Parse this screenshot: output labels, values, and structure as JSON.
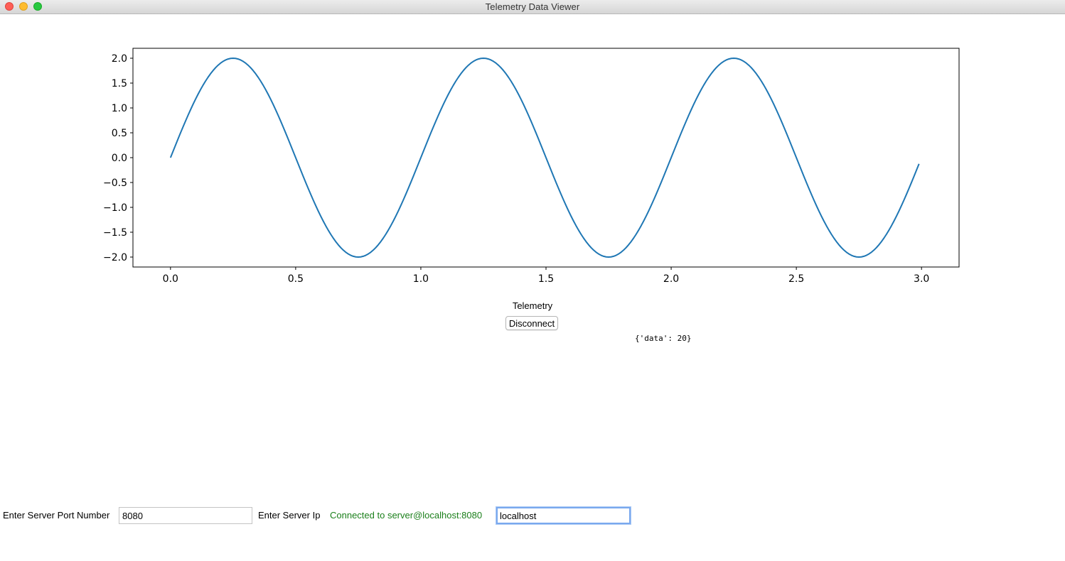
{
  "window": {
    "title": "Telemetry Data Viewer"
  },
  "chart_data": {
    "type": "line",
    "title": "",
    "xlabel": "",
    "ylabel": "",
    "xlim": [
      -0.15,
      3.15
    ],
    "ylim": [
      -2.2,
      2.2
    ],
    "xticks": [
      "0.0",
      "0.5",
      "1.0",
      "1.5",
      "2.0",
      "2.5",
      "3.0"
    ],
    "yticks": [
      "2.0",
      "1.5",
      "1.0",
      "0.5",
      "0.0",
      "−0.5",
      "−1.0",
      "−1.5",
      "−2.0"
    ],
    "grid": false,
    "series": [
      {
        "color": "#1f77b4",
        "function": "y = 2 * sin(2 * pi * x)",
        "x_start": 0.0,
        "x_end": 2.99,
        "x_step": 0.01
      }
    ]
  },
  "main": {
    "caption": "Telemetry",
    "disconnect_label": "Disconnect",
    "data_readout": "{'data': 20}"
  },
  "connection": {
    "port_label": "Enter Server Port Number",
    "port_value": "8080",
    "ip_label": "Enter Server Ip",
    "status_text": "Connected to server@localhost:8080",
    "status_color": "#1a7f1a",
    "ip_value": "localhost"
  }
}
